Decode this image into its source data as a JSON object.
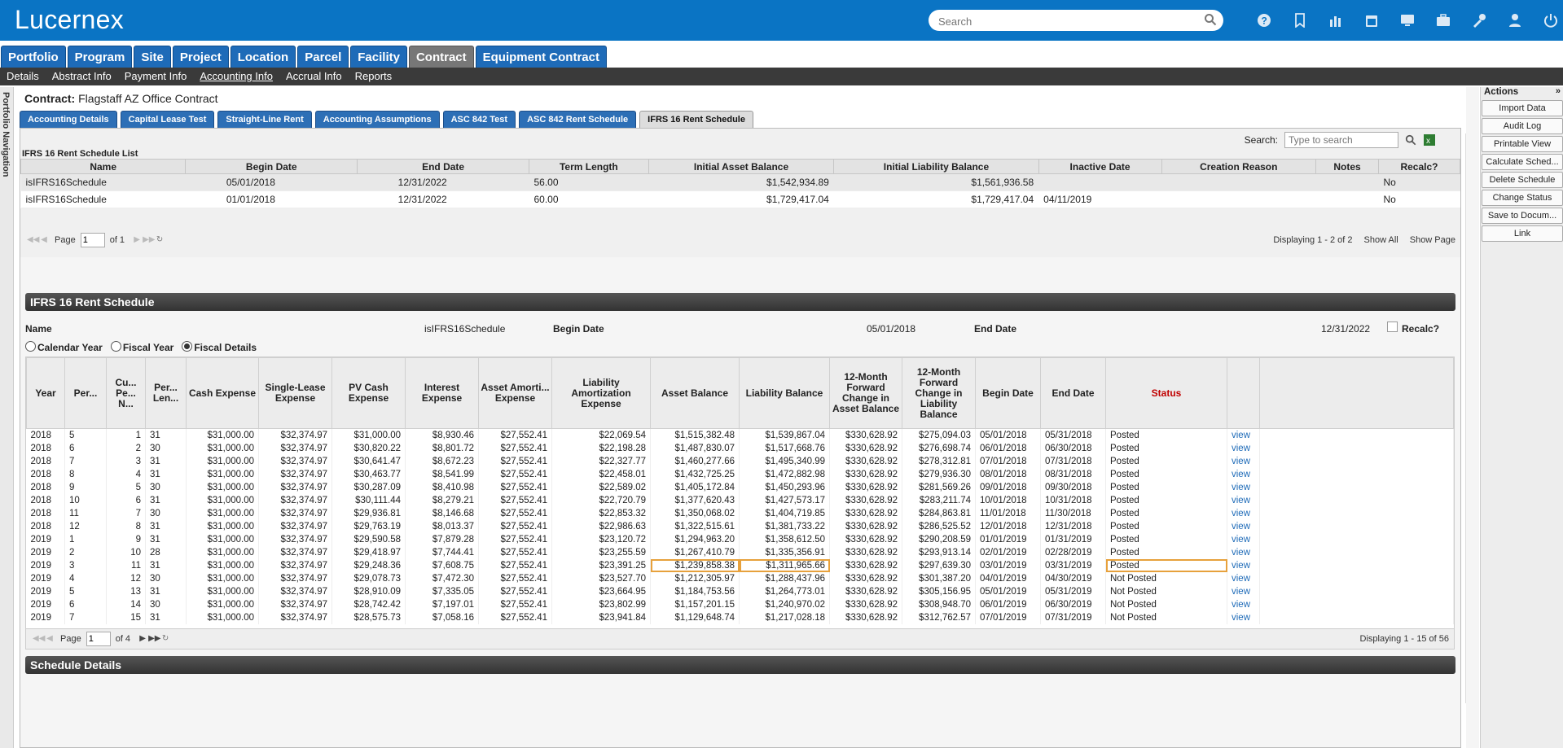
{
  "app": {
    "logo": "Lucernex",
    "search_placeholder": "Search"
  },
  "top_icons": [
    "help-icon",
    "bookmark-icon",
    "chart-icon",
    "calendar-icon",
    "monitor-icon",
    "briefcase-icon",
    "tools-icon",
    "user-icon",
    "power-icon"
  ],
  "module_tabs": [
    "Portfolio",
    "Program",
    "Site",
    "Project",
    "Location",
    "Parcel",
    "Facility",
    "Contract",
    "Equipment Contract"
  ],
  "active_module": "Contract",
  "sub_nav": [
    "Details",
    "Abstract Info",
    "Payment Info",
    "Accounting Info",
    "Accrual Info",
    "Reports"
  ],
  "active_sub_nav": "Accounting Info",
  "left_nav_label": "Portfolio Navigation",
  "contract": {
    "label": "Contract:",
    "name": "Flagstaff AZ Office Contract"
  },
  "acct_tabs": [
    "Accounting Details",
    "Capital Lease Test",
    "Straight-Line Rent",
    "Accounting Assumptions",
    "ASC 842 Test",
    "ASC 842 Rent Schedule",
    "IFRS 16 Rent Schedule"
  ],
  "active_acct_tab": "IFRS 16 Rent Schedule",
  "list": {
    "search_label": "Search:",
    "search_placeholder": "Type to search",
    "title": "IFRS 16 Rent Schedule List",
    "headers": [
      "Name",
      "Begin Date",
      "End Date",
      "Term Length",
      "Initial Asset Balance",
      "Initial Liability Balance",
      "Inactive Date",
      "Creation Reason",
      "Notes",
      "Recalc?"
    ],
    "rows": [
      [
        "isIFRS16Schedule",
        "05/01/2018",
        "12/31/2022",
        "56.00",
        "$1,542,934.89",
        "$1,561,936.58",
        "",
        "",
        "",
        "No"
      ],
      [
        "isIFRS16Schedule",
        "01/01/2018",
        "12/31/2022",
        "60.00",
        "$1,729,417.04",
        "$1,729,417.04",
        "04/11/2019",
        "",
        "",
        "No"
      ]
    ],
    "pager": {
      "page_label": "Page",
      "page": "1",
      "of": "of 1",
      "displaying": "Displaying 1 - 2 of 2",
      "show_all": "Show All",
      "show_page": "Show Page"
    }
  },
  "schedule": {
    "title": "IFRS 16 Rent Schedule",
    "name_label": "Name",
    "name_value": "isIFRS16Schedule",
    "begin_label": "Begin Date",
    "begin_value": "05/01/2018",
    "end_label": "End Date",
    "end_value": "12/31/2022",
    "recalc_label": "Recalc?",
    "radios": [
      "Calendar Year",
      "Fiscal Year",
      "Fiscal Details"
    ],
    "radio_selected": "Fiscal Details",
    "headers": [
      "Year",
      "Per...",
      "Cu... Pe... N...",
      "Per... Len...",
      "Cash Expense",
      "Single-Lease Expense",
      "PV Cash Expense",
      "Interest Expense",
      "Asset Amorti... Expense",
      "Liability Amortization Expense",
      "Asset Balance",
      "Liability Balance",
      "12-Month Forward Change in Asset Balance",
      "12-Month Forward Change in Liability Balance",
      "Begin Date",
      "End Date",
      "Status",
      ""
    ],
    "rows": [
      [
        "2018",
        "5",
        "1",
        "31",
        "$31,000.00",
        "$32,374.97",
        "$31,000.00",
        "$8,930.46",
        "$27,552.41",
        "$22,069.54",
        "$1,515,382.48",
        "$1,539,867.04",
        "$330,628.92",
        "$275,094.03",
        "05/01/2018",
        "05/31/2018",
        "Posted",
        "view"
      ],
      [
        "2018",
        "6",
        "2",
        "30",
        "$31,000.00",
        "$32,374.97",
        "$30,820.22",
        "$8,801.72",
        "$27,552.41",
        "$22,198.28",
        "$1,487,830.07",
        "$1,517,668.76",
        "$330,628.92",
        "$276,698.74",
        "06/01/2018",
        "06/30/2018",
        "Posted",
        "view"
      ],
      [
        "2018",
        "7",
        "3",
        "31",
        "$31,000.00",
        "$32,374.97",
        "$30,641.47",
        "$8,672.23",
        "$27,552.41",
        "$22,327.77",
        "$1,460,277.66",
        "$1,495,340.99",
        "$330,628.92",
        "$278,312.81",
        "07/01/2018",
        "07/31/2018",
        "Posted",
        "view"
      ],
      [
        "2018",
        "8",
        "4",
        "31",
        "$31,000.00",
        "$32,374.97",
        "$30,463.77",
        "$8,541.99",
        "$27,552.41",
        "$22,458.01",
        "$1,432,725.25",
        "$1,472,882.98",
        "$330,628.92",
        "$279,936.30",
        "08/01/2018",
        "08/31/2018",
        "Posted",
        "view"
      ],
      [
        "2018",
        "9",
        "5",
        "30",
        "$31,000.00",
        "$32,374.97",
        "$30,287.09",
        "$8,410.98",
        "$27,552.41",
        "$22,589.02",
        "$1,405,172.84",
        "$1,450,293.96",
        "$330,628.92",
        "$281,569.26",
        "09/01/2018",
        "09/30/2018",
        "Posted",
        "view"
      ],
      [
        "2018",
        "10",
        "6",
        "31",
        "$31,000.00",
        "$32,374.97",
        "$30,111.44",
        "$8,279.21",
        "$27,552.41",
        "$22,720.79",
        "$1,377,620.43",
        "$1,427,573.17",
        "$330,628.92",
        "$283,211.74",
        "10/01/2018",
        "10/31/2018",
        "Posted",
        "view"
      ],
      [
        "2018",
        "11",
        "7",
        "30",
        "$31,000.00",
        "$32,374.97",
        "$29,936.81",
        "$8,146.68",
        "$27,552.41",
        "$22,853.32",
        "$1,350,068.02",
        "$1,404,719.85",
        "$330,628.92",
        "$284,863.81",
        "11/01/2018",
        "11/30/2018",
        "Posted",
        "view"
      ],
      [
        "2018",
        "12",
        "8",
        "31",
        "$31,000.00",
        "$32,374.97",
        "$29,763.19",
        "$8,013.37",
        "$27,552.41",
        "$22,986.63",
        "$1,322,515.61",
        "$1,381,733.22",
        "$330,628.92",
        "$286,525.52",
        "12/01/2018",
        "12/31/2018",
        "Posted",
        "view"
      ],
      [
        "2019",
        "1",
        "9",
        "31",
        "$31,000.00",
        "$32,374.97",
        "$29,590.58",
        "$7,879.28",
        "$27,552.41",
        "$23,120.72",
        "$1,294,963.20",
        "$1,358,612.50",
        "$330,628.92",
        "$290,208.59",
        "01/01/2019",
        "01/31/2019",
        "Posted",
        "view"
      ],
      [
        "2019",
        "2",
        "10",
        "28",
        "$31,000.00",
        "$32,374.97",
        "$29,418.97",
        "$7,744.41",
        "$27,552.41",
        "$23,255.59",
        "$1,267,410.79",
        "$1,335,356.91",
        "$330,628.92",
        "$293,913.14",
        "02/01/2019",
        "02/28/2019",
        "Posted",
        "view"
      ],
      [
        "2019",
        "3",
        "11",
        "31",
        "$31,000.00",
        "$32,374.97",
        "$29,248.36",
        "$7,608.75",
        "$27,552.41",
        "$23,391.25",
        "$1,239,858.38",
        "$1,311,965.66",
        "$330,628.92",
        "$297,639.30",
        "03/01/2019",
        "03/31/2019",
        "Posted",
        "view"
      ],
      [
        "2019",
        "4",
        "12",
        "30",
        "$31,000.00",
        "$32,374.97",
        "$29,078.73",
        "$7,472.30",
        "$27,552.41",
        "$23,527.70",
        "$1,212,305.97",
        "$1,288,437.96",
        "$330,628.92",
        "$301,387.20",
        "04/01/2019",
        "04/30/2019",
        "Not Posted",
        "view"
      ],
      [
        "2019",
        "5",
        "13",
        "31",
        "$31,000.00",
        "$32,374.97",
        "$28,910.09",
        "$7,335.05",
        "$27,552.41",
        "$23,664.95",
        "$1,184,753.56",
        "$1,264,773.01",
        "$330,628.92",
        "$305,156.95",
        "05/01/2019",
        "05/31/2019",
        "Not Posted",
        "view"
      ],
      [
        "2019",
        "6",
        "14",
        "30",
        "$31,000.00",
        "$32,374.97",
        "$28,742.42",
        "$7,197.01",
        "$27,552.41",
        "$23,802.99",
        "$1,157,201.15",
        "$1,240,970.02",
        "$330,628.92",
        "$308,948.70",
        "06/01/2019",
        "06/30/2019",
        "Not Posted",
        "view"
      ],
      [
        "2019",
        "7",
        "15",
        "31",
        "$31,000.00",
        "$32,374.97",
        "$28,575.73",
        "$7,058.16",
        "$27,552.41",
        "$23,941.84",
        "$1,129,648.74",
        "$1,217,028.18",
        "$330,628.92",
        "$312,762.57",
        "07/01/2019",
        "07/31/2019",
        "Not Posted",
        "view"
      ]
    ],
    "highlight_row": 10,
    "pager": {
      "page_label": "Page",
      "page": "1",
      "of": "of 4",
      "displaying": "Displaying 1 - 15 of 56"
    }
  },
  "schedule_details_title": "Schedule Details",
  "actions": {
    "title": "Actions",
    "buttons": [
      "Import Data",
      "Audit Log",
      "Printable View",
      "Calculate Sched...",
      "Delete Schedule",
      "Change Status",
      "Save to Docum...",
      "Link"
    ]
  }
}
